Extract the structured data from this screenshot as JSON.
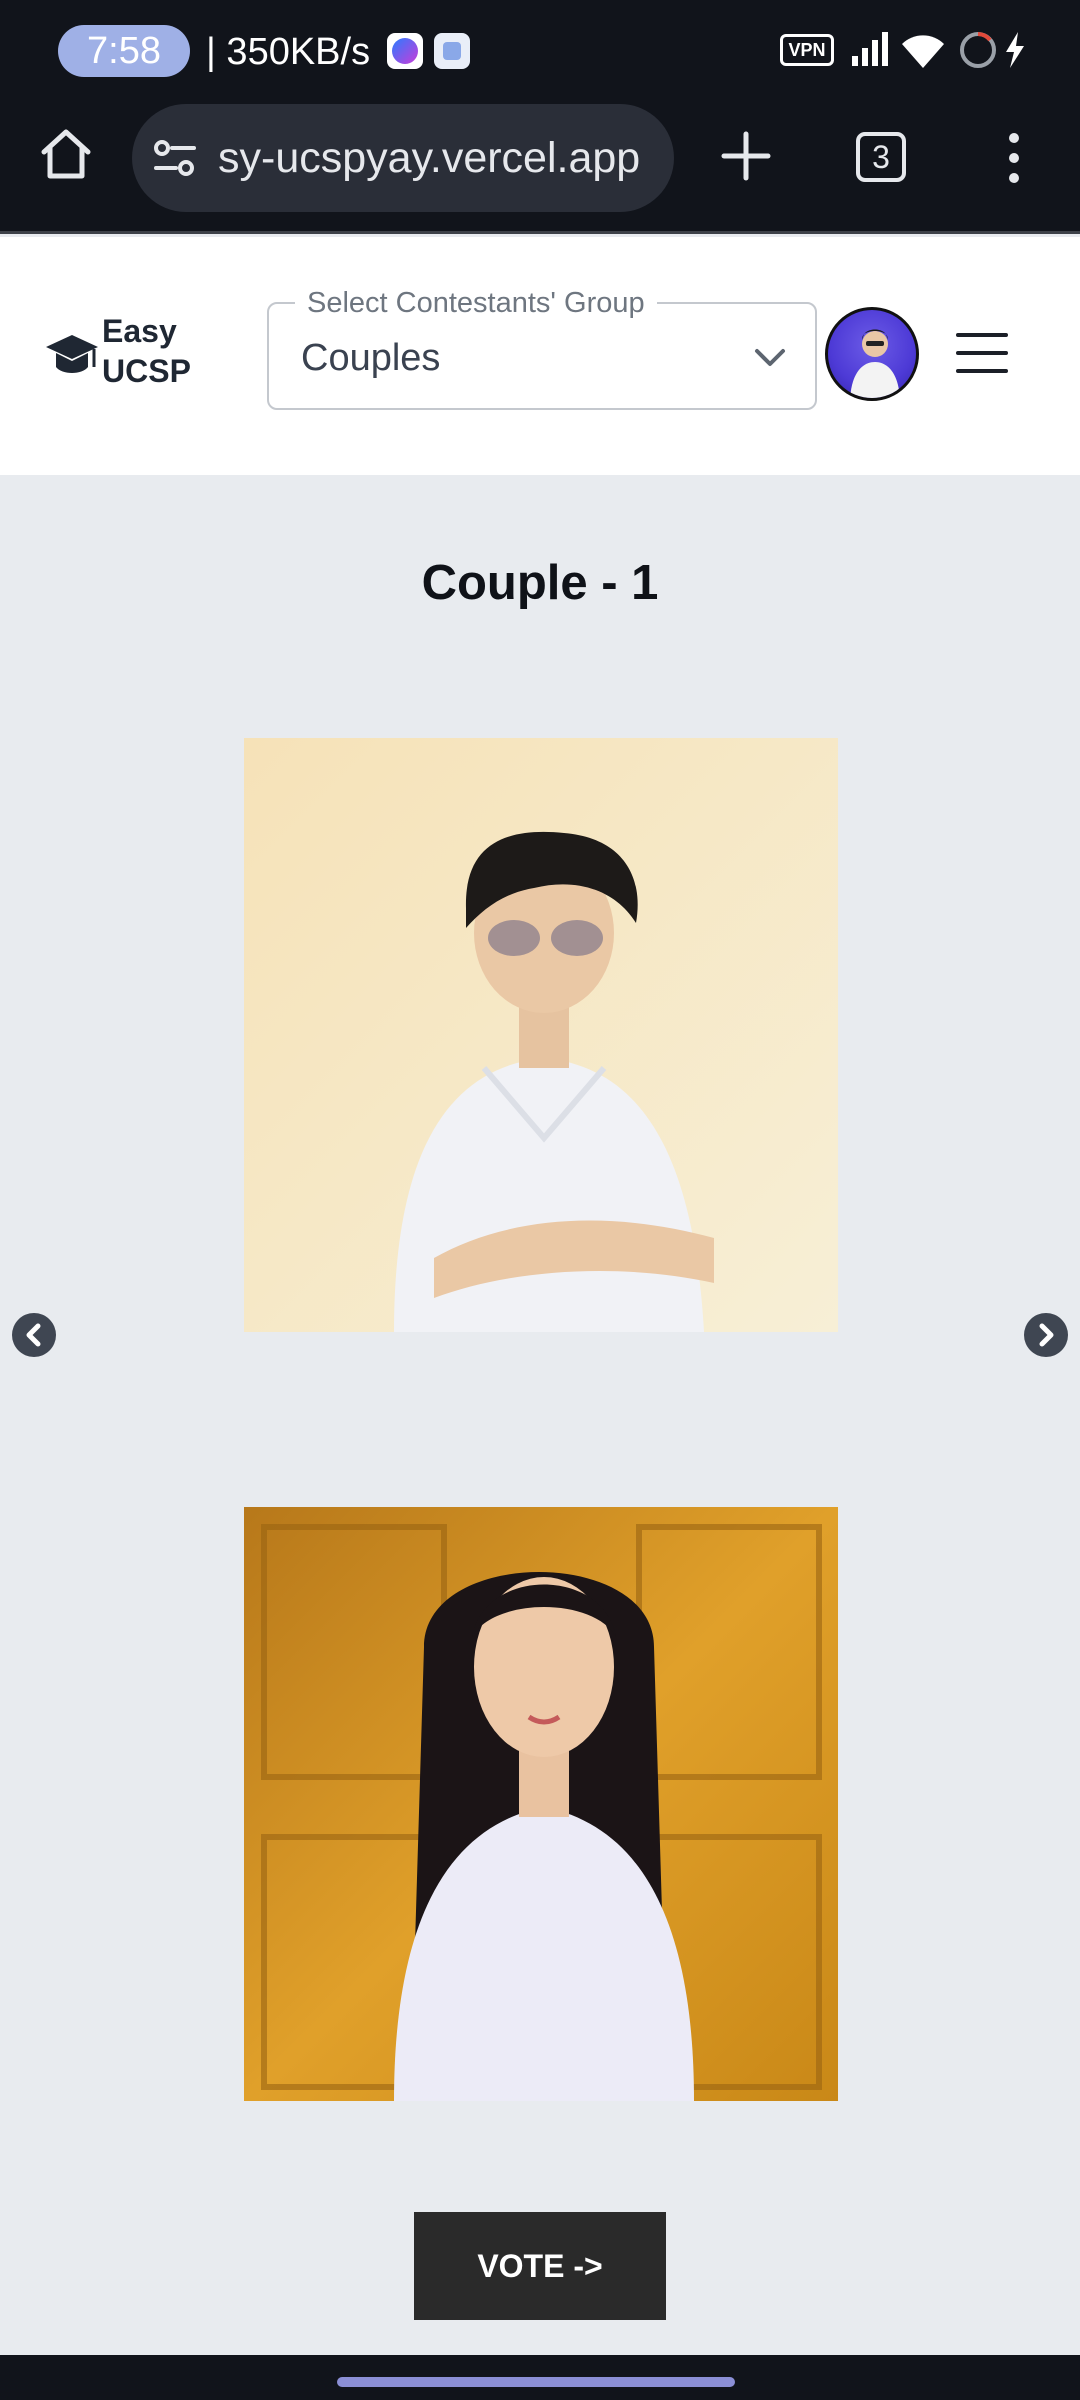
{
  "status_bar": {
    "time": "7:58",
    "net_speed": "| 350KB/s",
    "vpn": "VPN",
    "icons": [
      "messenger-icon",
      "app-icon",
      "signal-icon",
      "wifi-icon",
      "battery-icon",
      "charging-icon"
    ]
  },
  "browser": {
    "url": "sy-ucspyay.vercel.app",
    "tab_count": "3",
    "icons": [
      "home-icon",
      "site-settings-icon",
      "plus-icon",
      "more-vert-icon"
    ]
  },
  "header": {
    "logo_line1": "Easy",
    "logo_line2": "UCSP",
    "select_label": "Select Contestants' Group",
    "select_value": "Couples",
    "icons": [
      "graduation-cap-icon",
      "chevron-down-icon",
      "menu-icon"
    ]
  },
  "main": {
    "title": "Couple - 1",
    "vote_label": "VOTE ->",
    "icons": [
      "chevron-left-icon",
      "chevron-right-icon"
    ]
  },
  "colors": {
    "page_bg": "#e8ebef",
    "system_bar": "#11141b",
    "vote_button": "#2a2a2a",
    "avatar_bg": "#4d3ad6"
  }
}
